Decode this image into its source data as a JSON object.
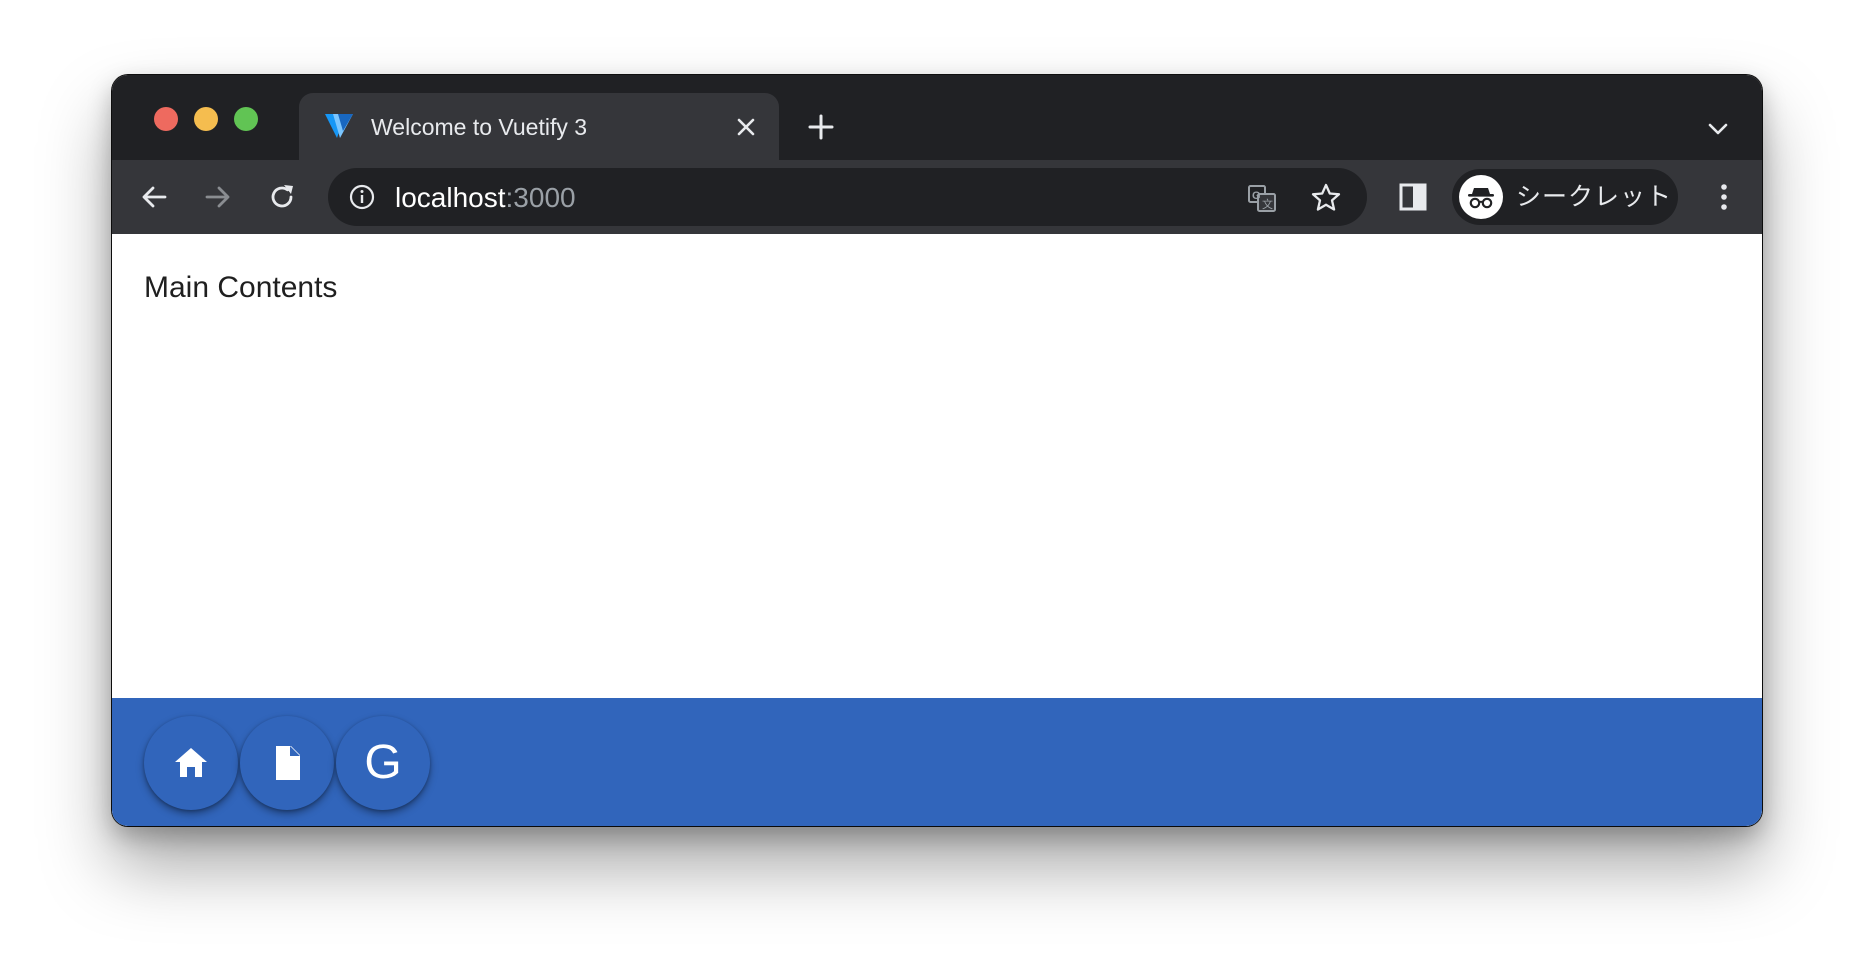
{
  "browser": {
    "tab": {
      "title": "Welcome to Vuetify 3",
      "favicon": "vuetify-logo-icon",
      "close_icon": "close-icon"
    },
    "new_tab_icon": "plus-icon",
    "tab_search_icon": "chevron-down-icon",
    "toolbar": {
      "back_icon": "arrow-left-icon",
      "forward_icon": "arrow-right-icon",
      "reload_icon": "reload-icon",
      "url_host": "localhost",
      "url_port": ":3000",
      "site_info_icon": "info-icon",
      "translate_icon": "translate-icon",
      "bookmark_icon": "star-icon",
      "side_panel_icon": "side-panel-icon",
      "incognito_label": "シークレット",
      "incognito_icon": "incognito-icon",
      "menu_icon": "more-vertical-icon"
    },
    "window_controls": [
      "close",
      "minimize",
      "zoom"
    ]
  },
  "page": {
    "main_text": "Main Contents",
    "footer": {
      "buttons": [
        {
          "icon": "home-icon"
        },
        {
          "icon": "file-icon"
        },
        {
          "icon": "google-icon",
          "glyph": "G"
        }
      ]
    }
  },
  "colors": {
    "chrome_dark": "#202124",
    "chrome_tab": "#35363a",
    "footer_blue": "#3165bb",
    "traffic_red": "#ee6a5f",
    "traffic_yellow": "#f5bd4f",
    "traffic_green": "#61c454"
  }
}
